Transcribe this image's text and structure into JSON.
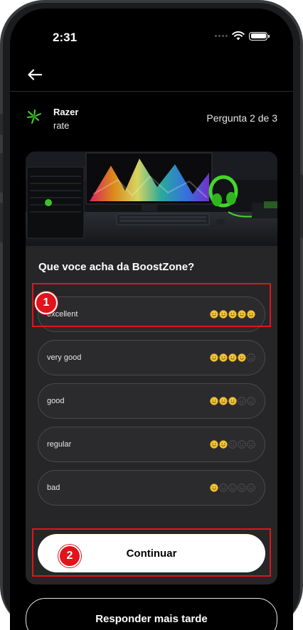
{
  "status_bar": {
    "time": "2:31"
  },
  "header": {
    "brand_name": "Razer",
    "brand_sub": "rate",
    "progress": "Pergunta 2 de 3"
  },
  "question": {
    "title": "Que voce acha da BoostZone?"
  },
  "options": [
    {
      "label": "excellent",
      "rating": 5
    },
    {
      "label": "very good",
      "rating": 4
    },
    {
      "label": "good",
      "rating": 3
    },
    {
      "label": "regular",
      "rating": 2
    },
    {
      "label": "bad",
      "rating": 1
    }
  ],
  "rating_max": 5,
  "buttons": {
    "continue_label": "Continuar",
    "later_label": "Responder mais tarde"
  },
  "annotations": {
    "marker_1": "1",
    "marker_2": "2"
  },
  "colors": {
    "accent_highlight": "#e3131b",
    "smiley_on": "#f3c83a",
    "smiley_off": "#3c3c3f",
    "brand_green": "#44d62c"
  }
}
